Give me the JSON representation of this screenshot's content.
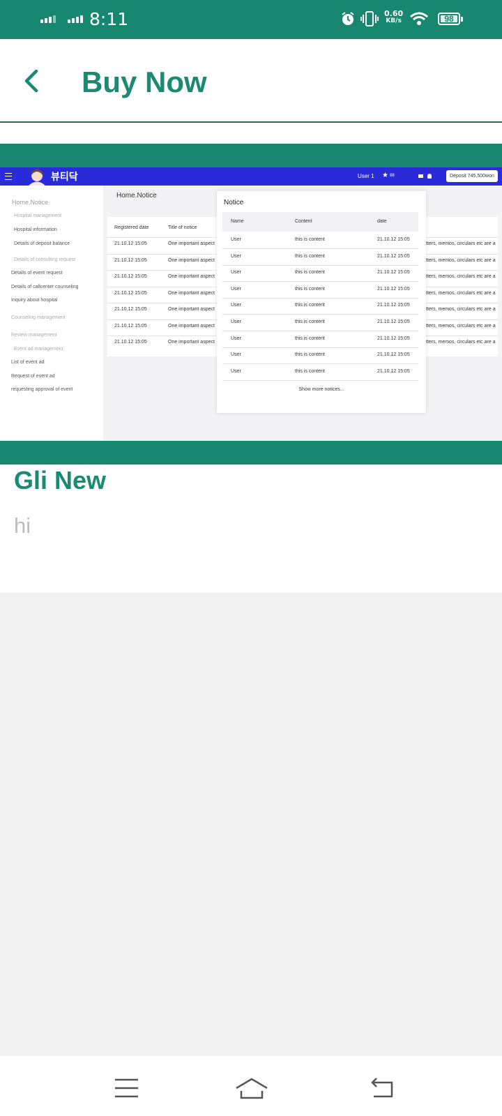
{
  "status_bar": {
    "time": "8:11",
    "speed_value": "0.60",
    "speed_unit": "KB/s",
    "battery": "98",
    "icons": [
      "signal-icon",
      "alarm-icon",
      "vibrate-icon",
      "wifi-icon",
      "battery-icon"
    ]
  },
  "header": {
    "back_icon": "chevron-left-icon",
    "title": "Buy Now"
  },
  "colors": {
    "brand": "#188770",
    "title_text": "#1c8a73",
    "placeholder_text": "#bdbdbd",
    "embedded_topbar": "#2b2bd9"
  },
  "post": {
    "title": "Gli New",
    "body": "hi",
    "image": {
      "topbar": {
        "logo_text": "뷰티닥",
        "user": "User 1",
        "points": "88",
        "deposit": "Deposit  745,500won"
      },
      "sidebar": {
        "breadcrumb": "Home.Notice",
        "items": [
          "Hospital management",
          "Hospital information",
          "Details of deposit balance",
          "Details of consulting request",
          "Details of event request",
          "Details of callcenter counseling",
          "Inquiry about hospital",
          "Counseling management",
          "Review management",
          "Event ad management",
          "List of event ad",
          "Request of event ad",
          "requesting approval of event"
        ]
      },
      "page_title": "Home.Notice",
      "table": {
        "headers": [
          "Registered date",
          "Title of notice"
        ],
        "rows": [
          {
            "date": "21.10.12 15:05",
            "title": "One important aspect",
            "tail": "tters, memos, circulars etc are a"
          },
          {
            "date": "21.10.12 15:05",
            "title": "One important aspect",
            "tail": "tters, memos, circulars etc are a"
          },
          {
            "date": "21.10.12 15:05",
            "title": "One important aspect",
            "tail": "tters, memos, circulars etc are a"
          },
          {
            "date": "21.10.12 15:05",
            "title": "One important aspect",
            "tail": "tters, memos, circulars etc are a"
          },
          {
            "date": "21.10.12 15:05",
            "title": "One important aspect",
            "tail": "tters, memos, circulars etc are a"
          },
          {
            "date": "21.10.12 15:05",
            "title": "One important aspect",
            "tail": "tters, memos, circulars etc are a"
          },
          {
            "date": "21.10.12 15:05",
            "title": "One important aspect",
            "tail": "tters, memos, circulars etc are a"
          }
        ]
      },
      "notice_modal": {
        "title": "Notice",
        "headers": [
          "Name",
          "Content",
          "date"
        ],
        "rows": [
          {
            "name": "User",
            "content": "this is content",
            "date": "21.10.12 15:05"
          },
          {
            "name": "User",
            "content": "this is content",
            "date": "21.10.12 15:05"
          },
          {
            "name": "User",
            "content": "this is content",
            "date": "21.10.12 15:05"
          },
          {
            "name": "User",
            "content": "this is content",
            "date": "21.10.12 15:05"
          },
          {
            "name": "User",
            "content": "this is content",
            "date": "21.10.12 15:05"
          },
          {
            "name": "User",
            "content": "this is content",
            "date": "21.10.12 15:05"
          },
          {
            "name": "User",
            "content": "this is content",
            "date": "21.10.12 15:05"
          },
          {
            "name": "User",
            "content": "this is content",
            "date": "21.10.12 15:05"
          },
          {
            "name": "User",
            "content": "this is content",
            "date": "21.10.12 15:05"
          }
        ],
        "show_more": "Show more notices..."
      }
    }
  },
  "nav_bar": {
    "icons": [
      "menu-icon",
      "home-icon",
      "back-icon"
    ]
  }
}
